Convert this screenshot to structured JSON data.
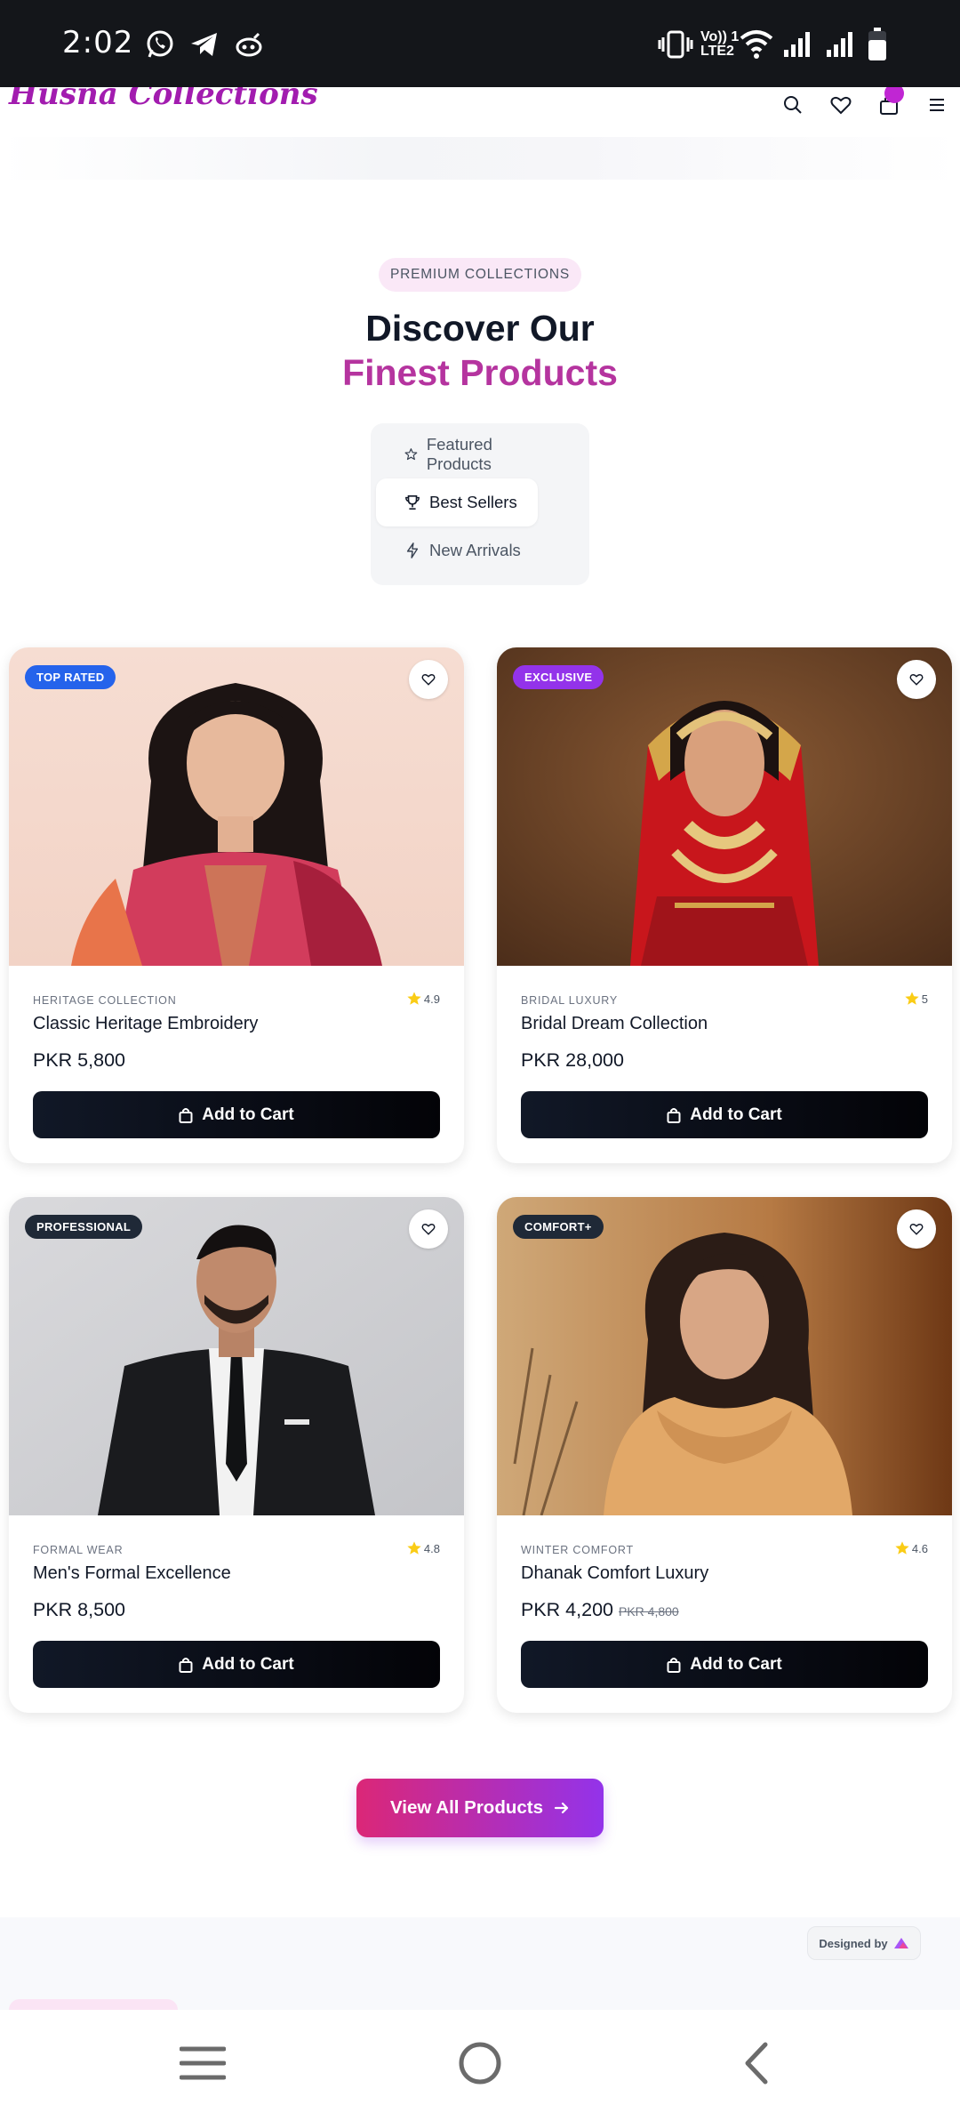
{
  "status_bar": {
    "time": "2:02",
    "lte_line1": "Vo)) 1",
    "lte_line2": "LTE2"
  },
  "header": {
    "brand": "Husna Collections",
    "icons": [
      "search-icon",
      "heart-icon",
      "cart-icon",
      "menu-icon"
    ]
  },
  "hero": {
    "pill": "PREMIUM COLLECTIONS",
    "title_line1": "Discover Our",
    "title_line2": "Finest Products",
    "accent_color": "#b5349f"
  },
  "tabs": [
    {
      "label": "Featured Products",
      "icon": "star-icon",
      "active": false
    },
    {
      "label": "Best Sellers",
      "icon": "trophy-icon",
      "active": true
    },
    {
      "label": "New Arrivals",
      "icon": "bolt-icon",
      "active": false
    }
  ],
  "products": [
    {
      "badge": "TOP RATED",
      "badge_color": "#2563eb",
      "category": "HERITAGE COLLECTION",
      "rating": "4.9",
      "name": "Classic Heritage Embroidery",
      "price": "PKR 5,800",
      "old_price": "",
      "cta": "Add to Cart"
    },
    {
      "badge": "EXCLUSIVE",
      "badge_color": "#9333ea",
      "category": "BRIDAL LUXURY",
      "rating": "5",
      "name": "Bridal Dream Collection",
      "price": "PKR 28,000",
      "old_price": "",
      "cta": "Add to Cart"
    },
    {
      "badge": "PROFESSIONAL",
      "badge_color": "#1f2937",
      "category": "FORMAL WEAR",
      "rating": "4.8",
      "name": "Men's Formal Excellence",
      "price": "PKR 8,500",
      "old_price": "",
      "cta": "Add to Cart"
    },
    {
      "badge": "COMFORT+",
      "badge_color": "#1f2937",
      "category": "WINTER COMFORT",
      "rating": "4.6",
      "name": "Dhanak Comfort Luxury",
      "price": "PKR 4,200",
      "old_price": "PKR 4,800",
      "cta": "Add to Cart"
    }
  ],
  "view_all": "View All Products",
  "designed_by": "Designed by",
  "colors": {
    "brand": "#a21caf",
    "button_dark": "#111827",
    "cta_gradient_start": "#db2777",
    "cta_gradient_end": "#9333ea"
  }
}
